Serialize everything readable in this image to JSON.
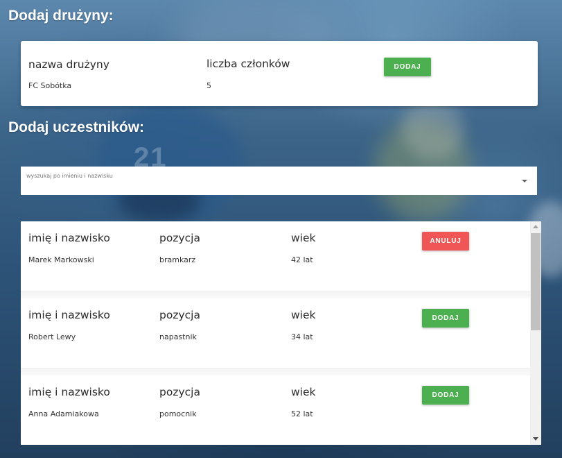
{
  "team_section": {
    "heading": "Dodaj drużyny:",
    "name_label": "nazwa drużyny",
    "name_value": "FC Sobótka",
    "count_label": "liczba członków",
    "count_value": "5",
    "add_button": "DODAJ"
  },
  "members_section": {
    "heading": "Dodaj uczestników:",
    "search_placeholder": "wyszukaj po imieniu i nazwisku"
  },
  "members": [
    {
      "name_label": "imię i nazwisko",
      "name": "Marek Markowski",
      "position_label": "pozycja",
      "position": "bramkarz",
      "age_label": "wiek",
      "age": "42 lat",
      "button": "ANULUJ",
      "button_color": "#f05656"
    },
    {
      "name_label": "imię i nazwisko",
      "name": "Robert Lewy",
      "position_label": "pozycja",
      "position": "napastnik",
      "age_label": "wiek",
      "age": "34 lat",
      "button": "DODAJ",
      "button_color": "#4caf50"
    },
    {
      "name_label": "imię i nazwisko",
      "name": "Anna Adamiakowa",
      "position_label": "pozycja",
      "position": "pomocnik",
      "age_label": "wiek",
      "age": "52 lat",
      "button": "DODAJ",
      "button_color": "#4caf50"
    }
  ],
  "colors": {
    "add_green": "#4caf50",
    "cancel_red": "#f05656",
    "background_blue": "#26486a"
  }
}
